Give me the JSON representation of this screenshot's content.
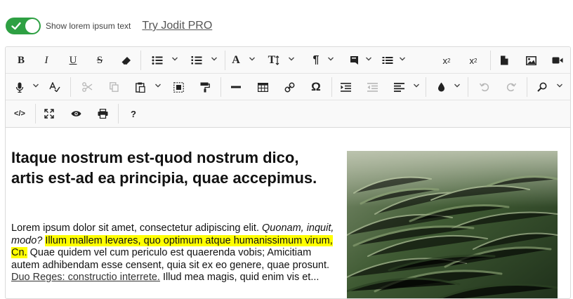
{
  "topbar": {
    "toggle_label": "Show lorem ipsum text",
    "pro_link": "Try Jodit PRO",
    "toggle_on": true,
    "toggle_color": "#2ea043"
  },
  "toolbar": {
    "row1": [
      {
        "name": "bold",
        "label": "B"
      },
      {
        "name": "italic",
        "label": "I"
      },
      {
        "name": "underline",
        "label": "U"
      },
      {
        "name": "strikethrough",
        "label": "S"
      },
      {
        "name": "eraser",
        "icon": "eraser-icon"
      },
      {
        "name": "unordered-list",
        "icon": "bullet-list-icon"
      },
      {
        "name": "ordered-list",
        "icon": "numbered-list-icon"
      },
      {
        "name": "font",
        "label": "A"
      },
      {
        "name": "font-size",
        "label": "T"
      },
      {
        "name": "paragraph",
        "label": "¶"
      },
      {
        "name": "class-span",
        "icon": "block-icon"
      },
      {
        "name": "line-height",
        "icon": "line-height-icon"
      },
      {
        "name": "superscript",
        "label": "x",
        "sup": "2"
      },
      {
        "name": "subscript",
        "label": "x",
        "sub": "2"
      },
      {
        "name": "file",
        "icon": "file-icon"
      },
      {
        "name": "image",
        "icon": "image-icon"
      },
      {
        "name": "video",
        "icon": "video-icon"
      }
    ],
    "row2": [
      {
        "name": "speech-recognize",
        "icon": "microphone-icon"
      },
      {
        "name": "spellcheck",
        "icon": "spellcheck-icon"
      },
      {
        "name": "cut",
        "icon": "scissors-icon"
      },
      {
        "name": "copy",
        "icon": "copy-icon"
      },
      {
        "name": "paste",
        "icon": "paste-icon"
      },
      {
        "name": "select-all",
        "icon": "select-all-icon"
      },
      {
        "name": "copy-format",
        "icon": "paint-roller-icon"
      },
      {
        "name": "hr",
        "icon": "horizontal-rule-icon"
      },
      {
        "name": "table",
        "icon": "table-icon"
      },
      {
        "name": "link",
        "icon": "link-icon"
      },
      {
        "name": "symbols",
        "label": "Ω"
      },
      {
        "name": "indent",
        "icon": "indent-icon"
      },
      {
        "name": "outdent",
        "icon": "outdent-icon"
      },
      {
        "name": "align",
        "icon": "align-left-icon"
      },
      {
        "name": "brush",
        "icon": "droplet-icon"
      },
      {
        "name": "undo",
        "icon": "undo-icon"
      },
      {
        "name": "redo",
        "icon": "redo-icon"
      },
      {
        "name": "find",
        "icon": "search-icon"
      }
    ],
    "row3": [
      {
        "name": "source",
        "label": "</>"
      },
      {
        "name": "fullsize",
        "icon": "fullscreen-icon"
      },
      {
        "name": "preview",
        "icon": "eye-icon"
      },
      {
        "name": "print",
        "icon": "printer-icon"
      },
      {
        "name": "about",
        "label": "?"
      }
    ]
  },
  "content": {
    "heading": "Itaque nostrum est-quod nostrum dico, artis est-ad ea principia, quae accepimus.",
    "para": {
      "t1": "Lorem ipsum dolor sit amet, consectetur adipiscing elit. ",
      "em": "Quonam, inquit, modo?",
      "t2": " ",
      "highlight": "Illum mallem levares, quo optimum atque humanissimum virum, Cn.",
      "t3": " Quae quidem vel cum periculo est quaerenda vobis; Amicitiam autem adhibendam esse censent, quia sit ex eo genere, quae prosunt. ",
      "link": "Duo Reges: constructio interrete.",
      "t4": " Illud mea magis, quid enim vis et... "
    },
    "highlight_color": "#ffff00",
    "image_alt": "wheat-field"
  }
}
